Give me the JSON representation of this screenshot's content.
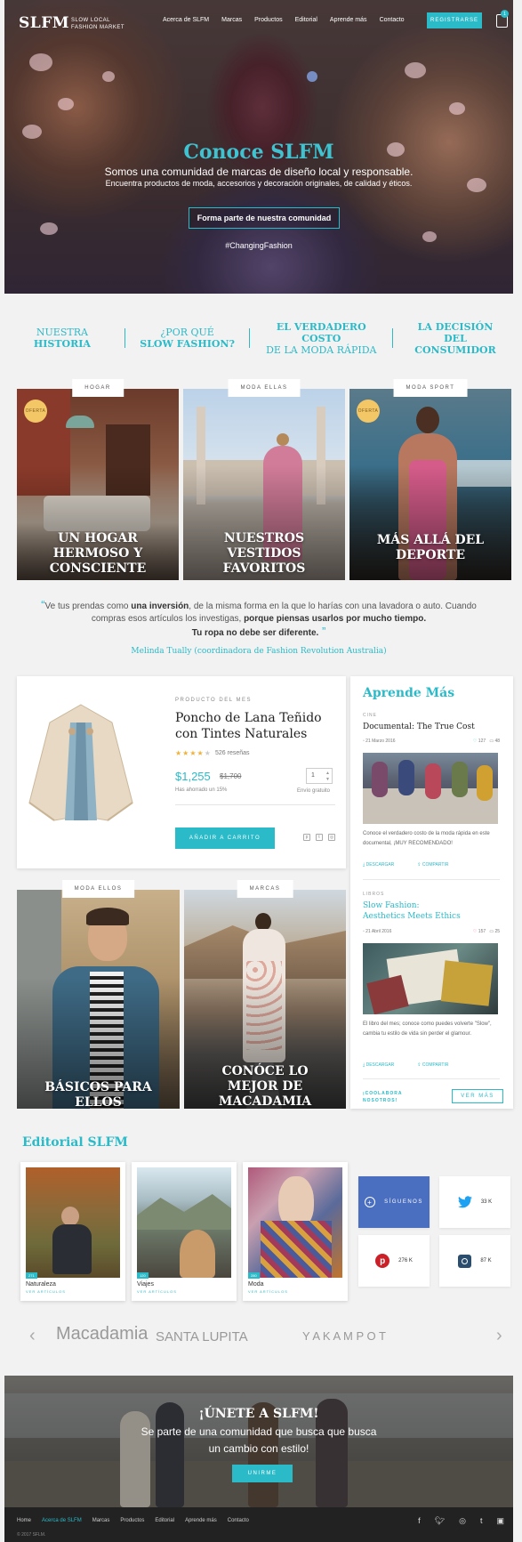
{
  "header": {
    "logo": "SLFM",
    "logo_sub": "SLOW LOCAL FASHION MARKET",
    "nav": [
      "Acerca de SLFM",
      "Marcas",
      "Productos",
      "Editorial",
      "Aprende más",
      "Contacto"
    ],
    "register_label": "REGISTRARSE",
    "cart_count": "1"
  },
  "hero": {
    "title": "Conoce SLFM",
    "subtitle": "Somos una comunidad de marcas de diseño local y responsable.",
    "subtitle2": "Encuentra productos de moda, accesorios y decoración originales, de calidad y éticos.",
    "cta": "Forma parte de nuestra comunidad",
    "hashtag": "#ChangingFashion"
  },
  "topics": [
    {
      "line1": "NUESTRA",
      "line2": "HISTORIA"
    },
    {
      "line1": "¿POR QUÉ",
      "line2": "SLOW FASHION?"
    },
    {
      "line1": "EL VERDADERO COSTO",
      "line2": "DE LA MODA RÁPIDA"
    },
    {
      "line1": "LA DECISIÓN",
      "line2": "DEL CONSUMIDOR"
    }
  ],
  "categories": [
    {
      "label": "HOGAR",
      "title": "UN HOGAR HERMOSO Y CONSCIENTE",
      "badge": "OFERTA"
    },
    {
      "label": "MODA ELLAS",
      "title": "NUESTROS VESTIDOS FAVORITOS"
    },
    {
      "label": "MODA SPORT",
      "title": "MÁS ALLÁ DEL DEPORTE",
      "badge": "OFERTA"
    },
    {
      "label": "MODA ELLOS",
      "title": "BÁSICOS PARA ELLOS"
    },
    {
      "label": "MARCAS",
      "title": "CONÓCE LO MEJOR DE MACADAMIA"
    }
  ],
  "quote": {
    "part1": "Ve tus prendas como ",
    "bold1": "una inversión",
    "part2": ", de la misma forma en la que lo harías con una lavadora o auto. Cuando compras esos artículos los investigas, ",
    "bold2": "porque piensas usarlos por mucho tiempo.",
    "bold3": "Tu ropa no debe ser diferente.",
    "author": "Melinda Tually (coordinadora de Fashion Revolution Australia)"
  },
  "product": {
    "eyebrow": "PRODUCTO DEL MES",
    "title": "Poncho de Lana Teñido con Tintes Naturales",
    "rating": 4,
    "reviews": "526 reseñas",
    "price": "$1,255",
    "old_price": "$1,700",
    "saved": "Has ahorrado un 15%",
    "qty": "1",
    "shipping": "Envío gratuito",
    "add_cart": "AÑADIR A CARRITO"
  },
  "aprende": {
    "title": "Aprende Más",
    "articles": [
      {
        "category": "CINE",
        "title": "Documental: The True Cost",
        "date": "21 Marzo 2016",
        "likes": "127",
        "comments": "48",
        "text": "Conoce el verdadero costo de la moda rápida en este documental, ¡MUY RECOMENDADO!",
        "download": "DESCARGAR",
        "share": "COMPARTIR"
      },
      {
        "category": "LIBROS",
        "title": "Slow Fashion: Aesthetics Meets Ethics",
        "date": "21 Abril 2016",
        "likes": "157",
        "comments": "25",
        "text": "El libro del mes; conoce como puedes volverte \"Slow\", cambia tu estilo de vida sin perder el glamour.",
        "download": "DESCARGAR",
        "share": "COMPARTIR"
      }
    ],
    "collab_line1": "¡COOLABORA",
    "collab_line2": "NOSOTROS!",
    "ver_mas": "VER MÁS"
  },
  "editorial": {
    "title": "Editorial SLFM",
    "items": [
      {
        "name": "Naturaleza",
        "count": "271",
        "sub": "VER ARTÍCULOS"
      },
      {
        "name": "Viajes",
        "count": "120",
        "sub": "VER ARTÍCULOS"
      },
      {
        "name": "Moda",
        "count": "280",
        "sub": "VER ARTÍCULOS"
      }
    ],
    "social": {
      "follow": "SÍGUENOS",
      "twitter": "33 K",
      "pinterest": "276 K",
      "instagram": "87 K"
    }
  },
  "brands": [
    "Macadamia",
    "SANTA LUPITA",
    "Y A K A M P O T"
  ],
  "join": {
    "title": "¡ÚNETE A SLFM!",
    "subtitle": "Se parte de una comunidad que busca que busca un cambio con estilo!",
    "button": "UNIRME"
  },
  "footer": {
    "nav": [
      "Home",
      "Acerca de SLFM",
      "Marcas",
      "Productos",
      "Editorial",
      "Aprende más",
      "Contacto"
    ],
    "active": "Acerca de SLFM",
    "copyright": "© 2017 SFLM."
  },
  "colors": {
    "accent": "#2bbac8",
    "facebook": "#4a6ec0",
    "twitter": "#1da1f2",
    "pinterest": "#cb2027",
    "instagram": "#2b4e6e"
  }
}
